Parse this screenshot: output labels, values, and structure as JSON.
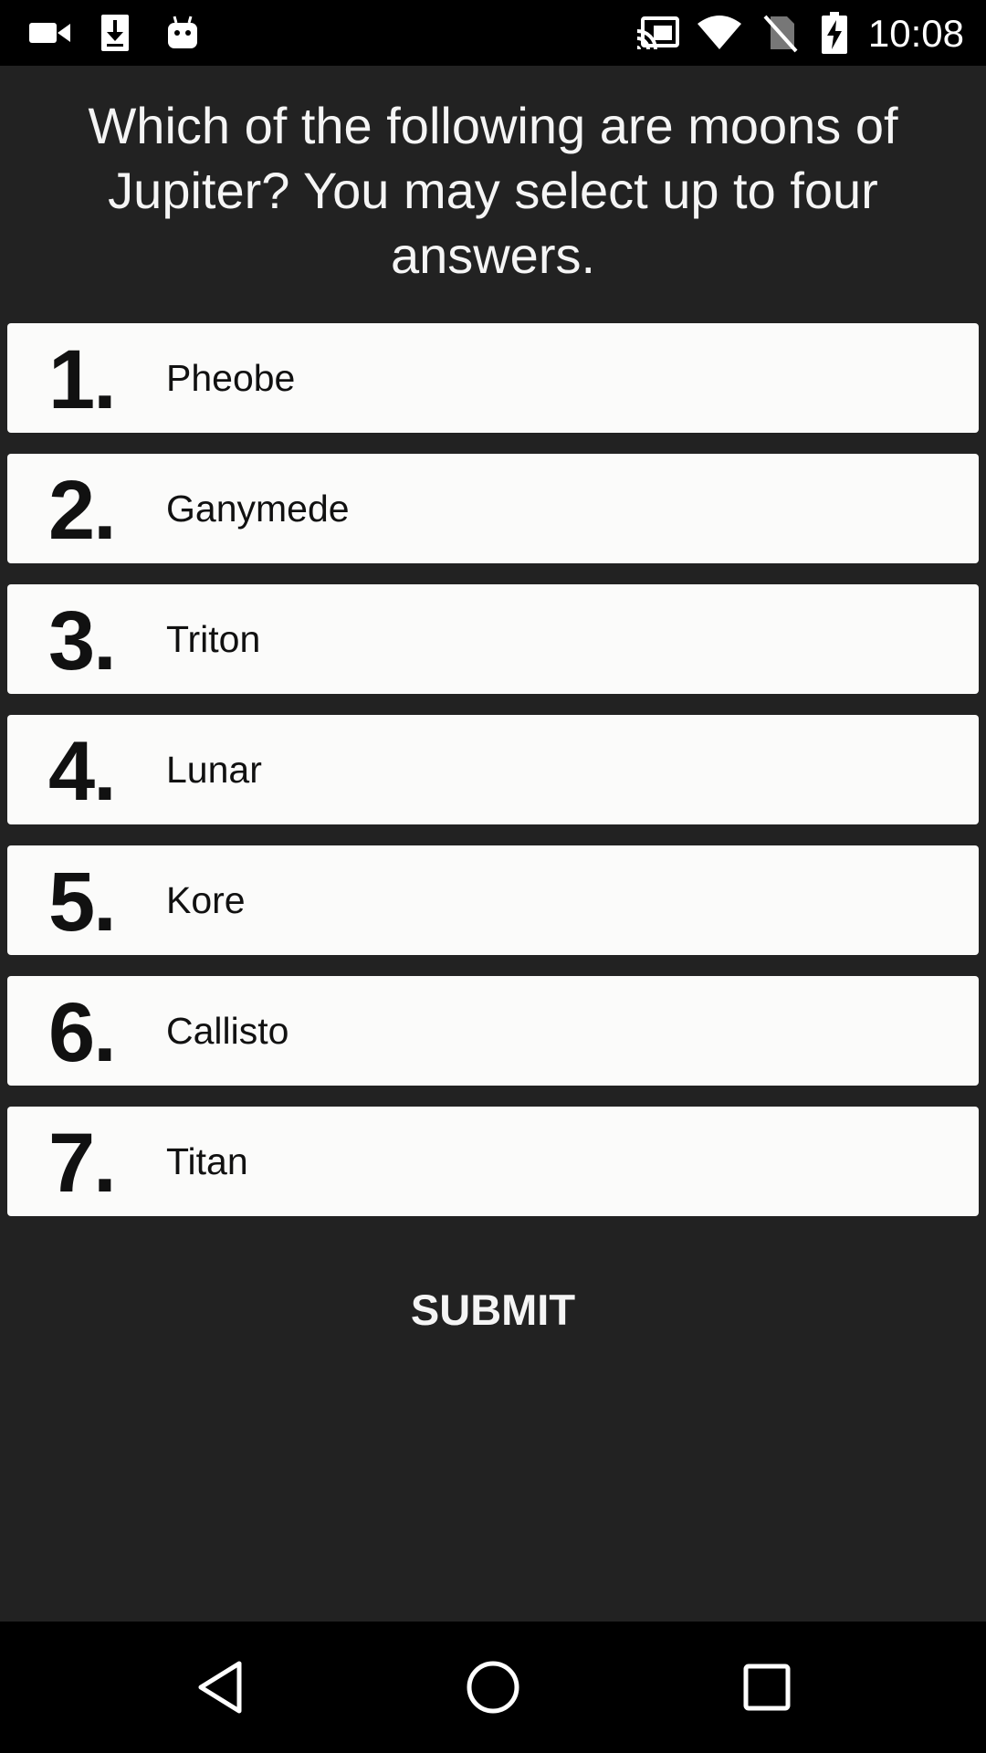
{
  "status_bar": {
    "time": "10:08",
    "left_icons": [
      "video-camera-icon",
      "download-icon",
      "android-icon"
    ],
    "right_icons": [
      "cast-icon",
      "wifi-icon",
      "no-sim-icon",
      "battery-charging-icon"
    ]
  },
  "question": {
    "text": "Which of the following are moons of Jupiter? You may select up to four answers."
  },
  "answers": [
    {
      "number": "1.",
      "label": "Pheobe"
    },
    {
      "number": "2.",
      "label": "Ganymede"
    },
    {
      "number": "3.",
      "label": "Triton"
    },
    {
      "number": "4.",
      "label": "Lunar"
    },
    {
      "number": "5.",
      "label": "Kore"
    },
    {
      "number": "6.",
      "label": "Callisto"
    },
    {
      "number": "7.",
      "label": "Titan"
    }
  ],
  "submit": {
    "label": "SUBMIT"
  },
  "nav_bar": {
    "buttons": [
      "back-icon",
      "home-icon",
      "recents-icon"
    ]
  },
  "colors": {
    "background": "#222222",
    "card": "#fbfbfa",
    "text_light": "#f5f5f5",
    "text_dark": "#111111",
    "bars": "#000000"
  }
}
